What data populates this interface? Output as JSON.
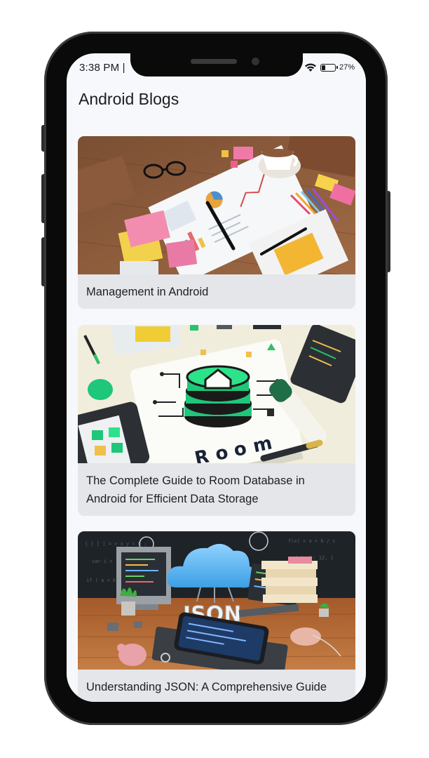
{
  "status_bar": {
    "time": "3:38 PM |",
    "battery_level_percent": 27,
    "battery_label": "27%",
    "icons": [
      "wifi-icon",
      "battery-icon"
    ]
  },
  "app": {
    "title": "Android Blogs"
  },
  "cards": [
    {
      "title": "Management in Android",
      "image_icon": "desk-workspace-illustration"
    },
    {
      "title": "The Complete Guide to Room Database in Android for Efficient Data Storage",
      "image_icon": "room-database-illustration"
    },
    {
      "title": "Understanding JSON: A Comprehensive Guide",
      "image_icon": "json-cloud-illustration",
      "image_text": "JSON"
    }
  ],
  "colors": {
    "screen_bg": "#f7f8fc",
    "card_bg": "#e4e6ea",
    "accent_green": "#21d07a",
    "cloud_blue": "#5bb8f0"
  }
}
